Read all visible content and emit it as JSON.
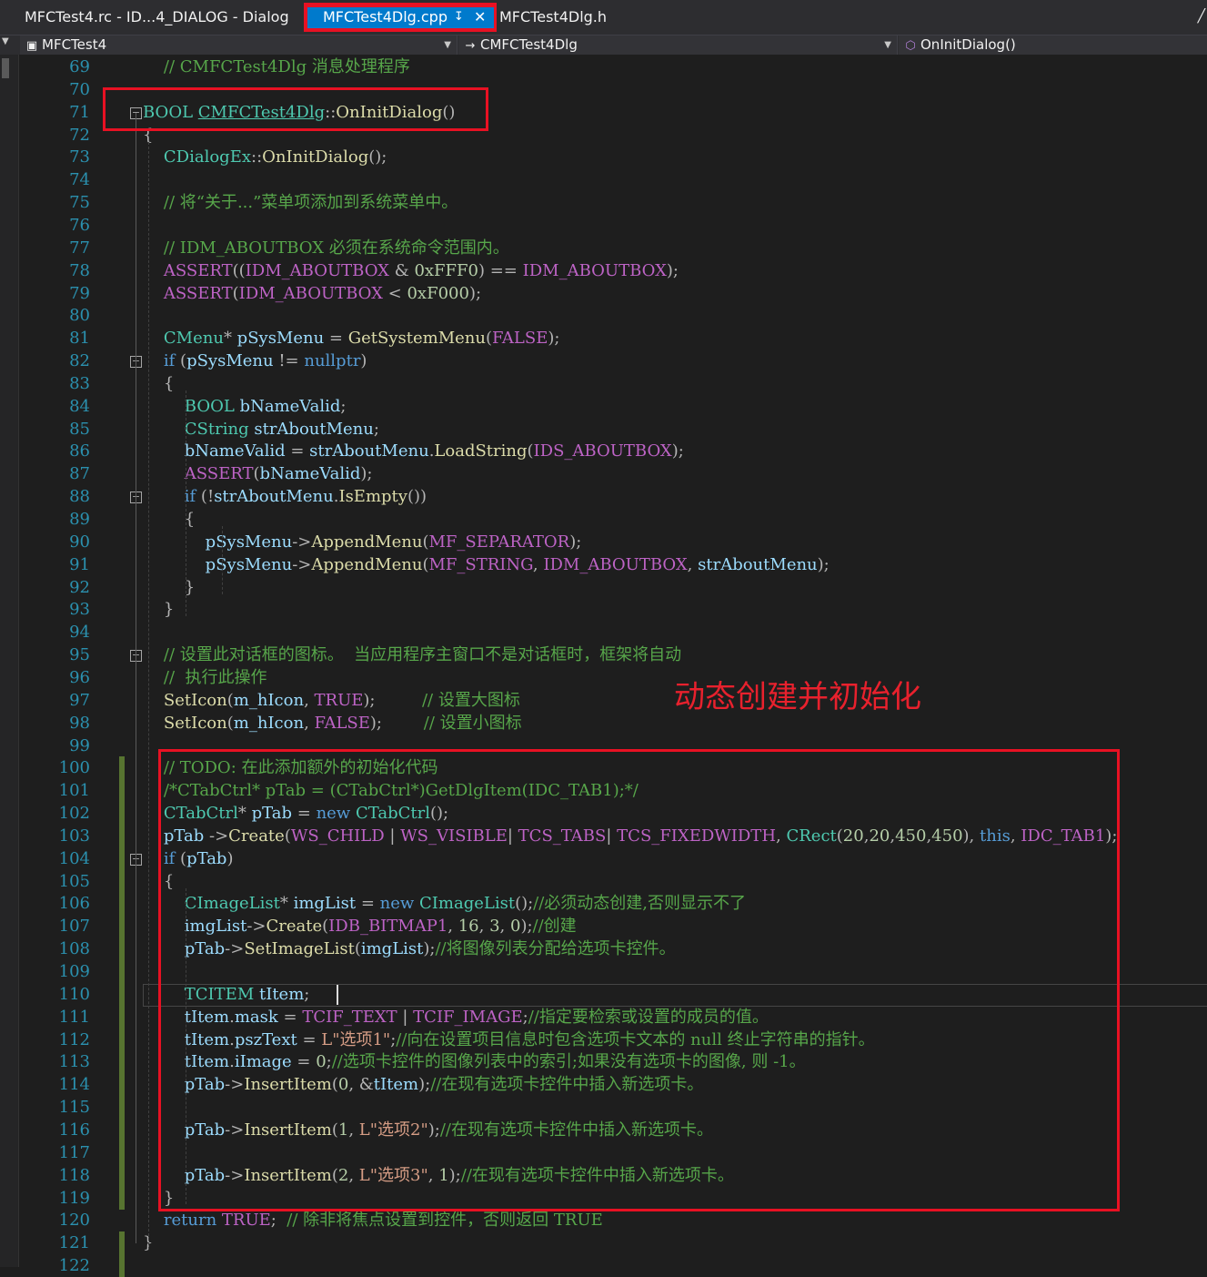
{
  "tabs": {
    "rc": "MFCTest4.rc - ID...4_DIALOG - Dialog",
    "cpp": "MFCTest4Dlg.cpp",
    "h": "MFCTest4Dlg.h"
  },
  "nav": {
    "project": "MFCTest4",
    "class": "CMFCTest4Dlg",
    "member": "OnInitDialog()"
  },
  "annotation": "动态创建并初始化",
  "line_numbers": [
    "69",
    "70",
    "71",
    "72",
    "73",
    "74",
    "75",
    "76",
    "77",
    "78",
    "79",
    "80",
    "81",
    "82",
    "83",
    "84",
    "85",
    "86",
    "87",
    "88",
    "89",
    "90",
    "91",
    "92",
    "93",
    "94",
    "95",
    "96",
    "97",
    "98",
    "99",
    "100",
    "101",
    "102",
    "103",
    "104",
    "105",
    "106",
    "107",
    "108",
    "109",
    "110",
    "111",
    "112",
    "113",
    "114",
    "115",
    "116",
    "117",
    "118",
    "119",
    "120",
    "121",
    "122"
  ],
  "code_lines": [
    "    // CMFCTest4Dlg 消息处理程序",
    "",
    "BOOL CMFCTest4Dlg::OnInitDialog()",
    "{",
    "    CDialogEx::OnInitDialog();",
    "",
    "    // 将“关于...”菜单项添加到系统菜单中。",
    "",
    "    // IDM_ABOUTBOX 必须在系统命令范围内。",
    "    ASSERT((IDM_ABOUTBOX & 0xFFF0) == IDM_ABOUTBOX);",
    "    ASSERT(IDM_ABOUTBOX < 0xF000);",
    "",
    "    CMenu* pSysMenu = GetSystemMenu(FALSE);",
    "    if (pSysMenu != nullptr)",
    "    {",
    "        BOOL bNameValid;",
    "        CString strAboutMenu;",
    "        bNameValid = strAboutMenu.LoadString(IDS_ABOUTBOX);",
    "        ASSERT(bNameValid);",
    "        if (!strAboutMenu.IsEmpty())",
    "        {",
    "            pSysMenu->AppendMenu(MF_SEPARATOR);",
    "            pSysMenu->AppendMenu(MF_STRING, IDM_ABOUTBOX, strAboutMenu);",
    "        }",
    "    }",
    "",
    "    // 设置此对话框的图标。  当应用程序主窗口不是对话框时，框架将自动",
    "    //  执行此操作",
    "    SetIcon(m_hIcon, TRUE);         // 设置大图标",
    "    SetIcon(m_hIcon, FALSE);        // 设置小图标",
    "",
    "    // TODO: 在此添加额外的初始化代码",
    "    /*CTabCtrl* pTab = (CTabCtrl*)GetDlgItem(IDC_TAB1);*/",
    "    CTabCtrl* pTab = new CTabCtrl();",
    "    pTab ->Create(WS_CHILD | WS_VISIBLE| TCS_TABS| TCS_FIXEDWIDTH, CRect(20,20,450,450), this, IDC_TAB1);",
    "    if (pTab)",
    "    {",
    "        CImageList* imgList = new CImageList();//必须动态创建,否则显示不了",
    "        imgList->Create(IDB_BITMAP1, 16, 3, 0);//创建",
    "        pTab->SetImageList(imgList);//将图像列表分配给选项卡控件。",
    "",
    "        TCITEM tItem;",
    "        tItem.mask = TCIF_TEXT | TCIF_IMAGE;//指定要检索或设置的成员的值。",
    "        tItem.pszText = L\"选项1\";//向在设置项目信息时包含选项卡文本的 null 终止字符串的指针。",
    "        tItem.iImage = 0;//选项卡控件的图像列表中的索引;如果没有选项卡的图像, 则 -1。",
    "        pTab->InsertItem(0, &tItem);//在现有选项卡控件中插入新选项卡。",
    "",
    "        pTab->InsertItem(1, L\"选项2\");//在现有选项卡控件中插入新选项卡。",
    "",
    "        pTab->InsertItem(2, L\"选项3\", 1);//在现有选项卡控件中插入新选项卡。",
    "    }",
    "    return TRUE;  // 除非将焦点设置到控件，否则返回 TRUE",
    "}",
    ""
  ]
}
